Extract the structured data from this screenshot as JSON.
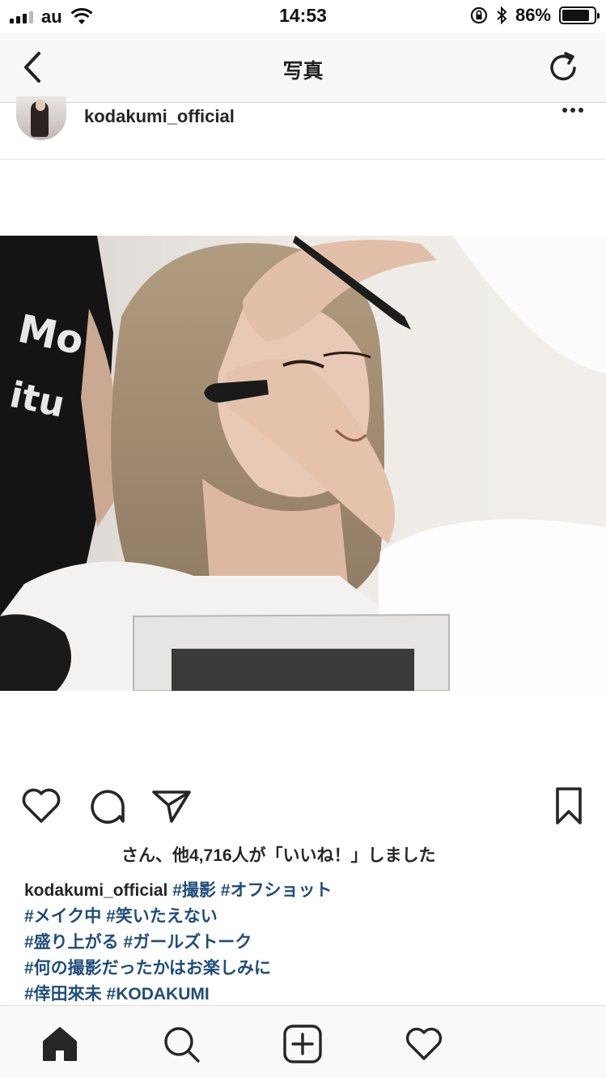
{
  "status_bar": {
    "carrier": "au",
    "time": "14:53",
    "battery_percent": "86%",
    "battery_level": 0.86,
    "icons": [
      "signal-icon",
      "wifi-icon",
      "orientation-lock-icon",
      "bluetooth-icon",
      "battery-icon"
    ]
  },
  "nav": {
    "title": "写真",
    "back_icon": "chevron-left-icon",
    "reload_icon": "reload-icon"
  },
  "post": {
    "username": "kodakumi_official",
    "more_icon": "more-dots-icon",
    "photo_icon": "photo",
    "actions": [
      "heart-icon",
      "comment-icon",
      "share-icon",
      "bookmark-icon"
    ],
    "likes_text": "さん、他4,716人が「いいね！」しました",
    "caption": {
      "username": "kodakumi_official",
      "lines": [
        [
          "#撮影",
          "#オフショット"
        ],
        [
          "#メイク中",
          "#笑いたえない"
        ],
        [
          "#盛り上がる",
          "#ガールズトーク"
        ],
        [
          "#何の撮影だったかはお楽しみに"
        ],
        [
          "#倖田來未",
          "#KODAKUMI"
        ]
      ]
    }
  },
  "tab_bar": {
    "items": [
      "home-icon",
      "search-icon",
      "add-icon",
      "activity-heart-icon"
    ]
  }
}
